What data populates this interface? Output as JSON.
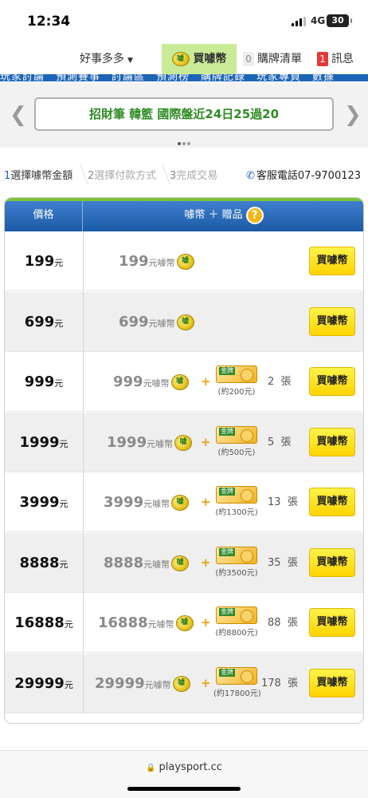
{
  "status_bar": {
    "time": "12:34",
    "network": "4G",
    "battery": "30"
  },
  "nav": {
    "haoshi_label": "好事多多",
    "buy_coins_label": "買噱幣",
    "cart_count": "0",
    "cart_label": "購牌清單",
    "msg_count": "1",
    "msg_label": "訊息",
    "strip_text": "玩家討論　預測賽事　討論區　預測榜　購牌記錄　玩家專頁　數據"
  },
  "banner": {
    "text": "招財筆 韓籃 國際盤近24日25過20"
  },
  "steps": {
    "step1_num": "1",
    "step1_label": "選擇噱幣金額",
    "step2_num": "2",
    "step2_label": "選擇付款方式",
    "step3_num": "3",
    "step3_label": "完成交易",
    "phone_label": "客服電話07-9700123"
  },
  "table": {
    "header_price": "價格",
    "header_coins": "噱幣 ＋ 贈品",
    "coin_glyph": "噱",
    "unit_yuan": "元",
    "coin_unit": "元噱幣",
    "plus": "+",
    "ticket_unit": "張",
    "buy_label": "買噱幣",
    "rows": [
      {
        "price": "199",
        "coins": "199"
      },
      {
        "price": "699",
        "coins": "699"
      },
      {
        "price": "999",
        "coins": "999",
        "ticket_note": "(約200元)",
        "count": "2"
      },
      {
        "price": "1999",
        "coins": "1999",
        "ticket_note": "(約500元)",
        "count": "5"
      },
      {
        "price": "3999",
        "coins": "3999",
        "ticket_note": "(約1300元)",
        "count": "13"
      },
      {
        "price": "8888",
        "coins": "8888",
        "ticket_note": "(約3500元)",
        "count": "35"
      },
      {
        "price": "16888",
        "coins": "16888",
        "ticket_note": "(約8800元)",
        "count": "88"
      },
      {
        "price": "29999",
        "coins": "29999",
        "ticket_note": "(約17800元)",
        "count": "178"
      }
    ]
  },
  "browser": {
    "url": "playsport.cc"
  }
}
